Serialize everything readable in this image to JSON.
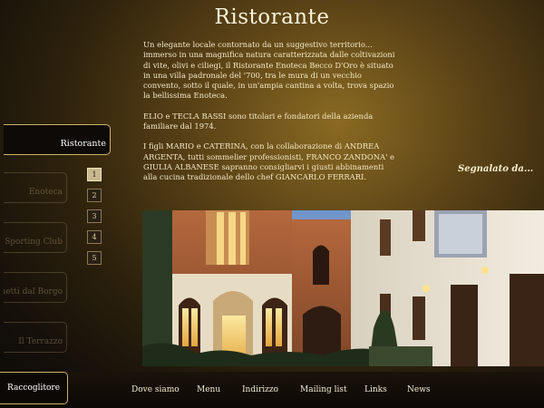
{
  "page": {
    "title": "Ristorante"
  },
  "intro": {
    "p1": "Un elegante locale contornato da un suggestivo territorio... immerso in una magnifica natura caratterizzata dalle coltivazioni di vite, olivi e ciliegi, il Ristorante Enoteca Becco D'Oro è situato in una villa padronale del '700, tra le mura di un vecchio convento, sotto il quale, in un'ampia cantina a volta, trova spazio la bellissima Enoteca.",
    "p2": "ELIO e TECLA BASSI sono titolari e fondatori della azienda familiare dal 1974.",
    "p3": "I figli MARIO e CATERINA, con la collaborazione di ANDREA ARGENTA, tutti sommelier professionisti, FRANCO ZANDONA' e GIULIA ALBANESE sapranno consigliarvi i giusti abbinamenti alla cucina tradizionale dello chef GIANCARLO FERRARI."
  },
  "side_tabs": [
    {
      "label": "Ristorante"
    },
    {
      "label": "Enoteca"
    },
    {
      "label": "Sporting Club"
    },
    {
      "label": "Banchetti dal Borgo"
    },
    {
      "label": "Il Terrazzo"
    }
  ],
  "pagination": [
    "1",
    "2",
    "3",
    "4",
    "5"
  ],
  "reported": "Segnalato da...",
  "nav": {
    "first": "Raccoglitore",
    "items": [
      "Dove siamo",
      "Menu",
      "Indirizzo",
      "Mailing list",
      "Links",
      "News"
    ]
  },
  "colors": {
    "accent": "#cfb36a",
    "background_dark": "#0c0906",
    "glow": "#8a6a22"
  }
}
